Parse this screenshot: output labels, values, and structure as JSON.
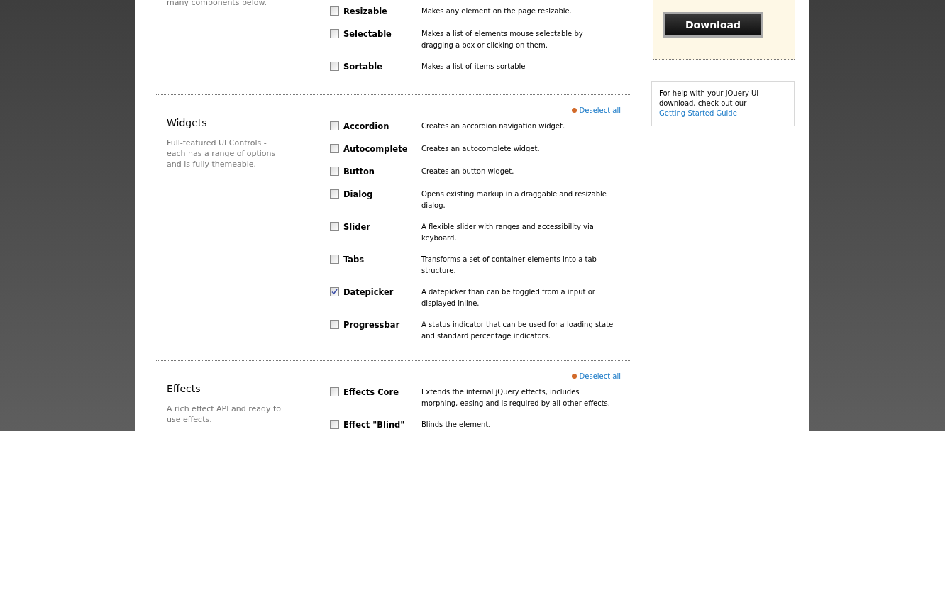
{
  "sections": [
    {
      "description": "many components below.",
      "items": [
        {
          "label": "Resizable",
          "description": "Makes any element on the page resizable.",
          "checked": false
        },
        {
          "label": "Selectable",
          "description": "Makes a list of elements mouse selectable by dragging a box or clicking on them.",
          "checked": false
        },
        {
          "label": "Sortable",
          "description": "Makes a list of items sortable",
          "checked": false
        }
      ]
    },
    {
      "title": "Widgets",
      "description": "Full-featured UI Controls - each has a range of options and is fully themeable.",
      "deselect_label": "Deselect all",
      "items": [
        {
          "label": "Accordion",
          "description": "Creates an accordion navigation widget.",
          "checked": false
        },
        {
          "label": "Autocomplete",
          "description": "Creates an autocomplete widget.",
          "checked": false
        },
        {
          "label": "Button",
          "description": "Creates an button widget.",
          "checked": false
        },
        {
          "label": "Dialog",
          "description": "Opens existing markup in a draggable and resizable dialog.",
          "checked": false
        },
        {
          "label": "Slider",
          "description": "A flexible slider with ranges and accessibility via keyboard.",
          "checked": false
        },
        {
          "label": "Tabs",
          "description": "Transforms a set of container elements into a tab structure.",
          "checked": false
        },
        {
          "label": "Datepicker",
          "description": "A datepicker than can be toggled from a input or displayed inline.",
          "checked": true
        },
        {
          "label": "Progressbar",
          "description": "A status indicator that can be used for a loading state and standard percentage indicators.",
          "checked": false
        }
      ]
    },
    {
      "title": "Effects",
      "description": "A rich effect API and ready to use effects.",
      "deselect_label": "Deselect all",
      "items": [
        {
          "label": "Effects Core",
          "description": "Extends the internal jQuery effects, includes morphing, easing and is required by all other effects.",
          "checked": false
        },
        {
          "label": "Effect \"Blind\"",
          "description": "Blinds the element.",
          "checked": false
        }
      ]
    }
  ],
  "sidebar": {
    "download_button": "Download",
    "help_text": "For help with your jQuery UI download, check out our ",
    "help_link": "Getting Started Guide"
  }
}
